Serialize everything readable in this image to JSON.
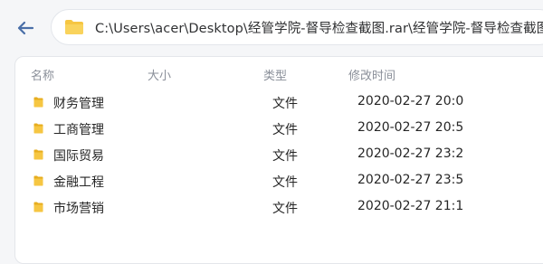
{
  "window": {
    "path": "C:\\Users\\acer\\Desktop\\经管学院-督导检查截图.rar\\经管学院-督导检查截图"
  },
  "columns": {
    "name": "名称",
    "size": "大小",
    "type": "类型",
    "modified": "修改时间"
  },
  "files": [
    {
      "name": "财务管理",
      "size": "",
      "type": "文件",
      "modified": "2020-02-27 20:0"
    },
    {
      "name": "工商管理",
      "size": "",
      "type": "文件",
      "modified": "2020-02-27 20:5"
    },
    {
      "name": "国际贸易",
      "size": "",
      "type": "文件",
      "modified": "2020-02-27 23:2"
    },
    {
      "name": "金融工程",
      "size": "",
      "type": "文件",
      "modified": "2020-02-27 23:5"
    },
    {
      "name": "市场营销",
      "size": "",
      "type": "文件",
      "modified": "2020-02-27 21:1"
    }
  ],
  "colors": {
    "folder": "#f6c642",
    "folder_dark": "#e7ad1e",
    "accent": "#4a6fa8"
  },
  "icons": {
    "back": "arrow-left-icon",
    "path": "folder-icon",
    "row": "folder-icon"
  }
}
